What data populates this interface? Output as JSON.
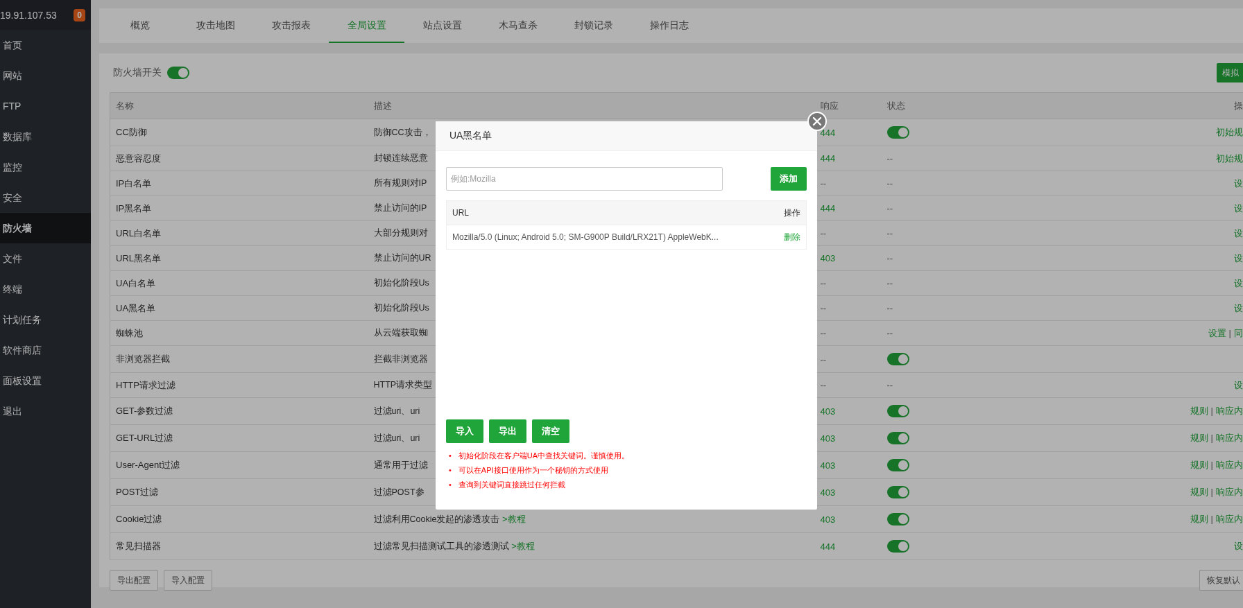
{
  "sidebar": {
    "host": "19.91.107.53",
    "badge": "0",
    "items": [
      {
        "label": "首页",
        "selected": false
      },
      {
        "label": "网站",
        "selected": false
      },
      {
        "label": "FTP",
        "selected": false
      },
      {
        "label": "数据库",
        "selected": false
      },
      {
        "label": "监控",
        "selected": false
      },
      {
        "label": "安全",
        "selected": false
      },
      {
        "label": "防火墙",
        "selected": true
      },
      {
        "label": "文件",
        "selected": false
      },
      {
        "label": "终端",
        "selected": false
      },
      {
        "label": "计划任务",
        "selected": false
      },
      {
        "label": "软件商店",
        "selected": false
      },
      {
        "label": "面板设置",
        "selected": false
      },
      {
        "label": "退出",
        "selected": false
      }
    ]
  },
  "tabs": [
    {
      "label": "概览",
      "selected": false
    },
    {
      "label": "攻击地图",
      "selected": false
    },
    {
      "label": "攻击报表",
      "selected": false
    },
    {
      "label": "全局设置",
      "selected": true
    },
    {
      "label": "站点设置",
      "selected": false
    },
    {
      "label": "木马查杀",
      "selected": false
    },
    {
      "label": "封锁记录",
      "selected": false
    },
    {
      "label": "操作日志",
      "selected": false
    }
  ],
  "firewall_switch": {
    "label": "防火墙开关",
    "on": true
  },
  "simulate_button": "模拟",
  "table": {
    "columns": [
      "名称",
      "描述",
      "响应",
      "状态",
      "操"
    ],
    "op_separator": "|",
    "rows": [
      {
        "name": "CC防御",
        "description": "防御CC攻击，",
        "response": {
          "kind": "code",
          "text": "444"
        },
        "status": {
          "kind": "switch",
          "on": true
        },
        "ops": [
          "初始规"
        ]
      },
      {
        "name": "恶意容忍度",
        "description": "封锁连续恶意",
        "response": {
          "kind": "code",
          "text": "444"
        },
        "status": {
          "kind": "text",
          "text": "--"
        },
        "ops": [
          "初始规"
        ]
      },
      {
        "name": "IP白名单",
        "description": "所有规则对IP",
        "response": {
          "kind": "none",
          "text": "--"
        },
        "status": {
          "kind": "text",
          "text": "--"
        },
        "ops": [
          "设"
        ]
      },
      {
        "name": "IP黑名单",
        "description": "禁止访问的IP",
        "response": {
          "kind": "code",
          "text": "444"
        },
        "status": {
          "kind": "text",
          "text": "--"
        },
        "ops": [
          "设"
        ]
      },
      {
        "name": "URL白名单",
        "description": "大部分规则对",
        "response": {
          "kind": "none",
          "text": "--"
        },
        "status": {
          "kind": "text",
          "text": "--"
        },
        "ops": [
          "设"
        ]
      },
      {
        "name": "URL黑名单",
        "description": "禁止访问的UR",
        "response": {
          "kind": "code",
          "text": "403"
        },
        "status": {
          "kind": "text",
          "text": "--"
        },
        "ops": [
          "设"
        ]
      },
      {
        "name": "UA白名单",
        "description": "初始化阶段Us",
        "response": {
          "kind": "none",
          "text": "--"
        },
        "status": {
          "kind": "text",
          "text": "--"
        },
        "ops": [
          "设"
        ]
      },
      {
        "name": "UA黑名单",
        "description": "初始化阶段Us",
        "response": {
          "kind": "none",
          "text": "--"
        },
        "status": {
          "kind": "text",
          "text": "--"
        },
        "ops": [
          "设"
        ]
      },
      {
        "name": "蜘蛛池",
        "description": "从云端获取蜘",
        "response": {
          "kind": "none",
          "text": "--"
        },
        "status": {
          "kind": "text",
          "text": "--"
        },
        "ops": [
          "设置",
          "同"
        ]
      },
      {
        "name": "非浏览器拦截",
        "description": "拦截非浏览器",
        "response": {
          "kind": "none",
          "text": "--"
        },
        "status": {
          "kind": "switch",
          "on": true
        },
        "ops": []
      },
      {
        "name": "HTTP请求过滤",
        "description": "HTTP请求类型",
        "response": {
          "kind": "none",
          "text": "--"
        },
        "status": {
          "kind": "text",
          "text": "--"
        },
        "ops": [
          "设"
        ]
      },
      {
        "name": "GET-参数过滤",
        "description": "过滤uri、uri",
        "response": {
          "kind": "code",
          "text": "403"
        },
        "status": {
          "kind": "switch",
          "on": true
        },
        "ops": [
          "规则",
          "响应内"
        ]
      },
      {
        "name": "GET-URL过滤",
        "description": "过滤uri、uri",
        "response": {
          "kind": "code",
          "text": "403"
        },
        "status": {
          "kind": "switch",
          "on": true
        },
        "ops": [
          "规则",
          "响应内"
        ]
      },
      {
        "name": "User-Agent过滤",
        "description": "通常用于过滤",
        "response": {
          "kind": "code",
          "text": "403"
        },
        "status": {
          "kind": "switch",
          "on": true
        },
        "ops": [
          "规则",
          "响应内"
        ]
      },
      {
        "name": "POST过滤",
        "description": "过滤POST参",
        "response": {
          "kind": "code",
          "text": "403"
        },
        "status": {
          "kind": "switch",
          "on": true
        },
        "ops": [
          "规则",
          "响应内"
        ]
      },
      {
        "name": "Cookie过滤",
        "description": "过滤利用Cookie发起的渗透攻击",
        "link": ">教程",
        "response": {
          "kind": "code",
          "text": "403"
        },
        "status": {
          "kind": "switch",
          "on": true
        },
        "ops": [
          "规则",
          "响应内"
        ]
      },
      {
        "name": "常见扫描器",
        "description": "过滤常见扫描测试工具的渗透测试",
        "link": ">教程",
        "response": {
          "kind": "code",
          "text": "444"
        },
        "status": {
          "kind": "switch",
          "on": true
        },
        "ops": [
          "设"
        ]
      }
    ]
  },
  "footer_buttons": [
    "导出配置",
    "导入配置"
  ],
  "restore_button": "恢复默认",
  "modal": {
    "title": "UA黑名单",
    "input": {
      "placeholder": "例如:Mozilla"
    },
    "add_button": "添加",
    "columns": [
      "URL",
      "操作"
    ],
    "rows": [
      {
        "ua": "Mozilla/5.0 (Linux; Android 5.0; SM-G900P Build/LRX21T) AppleWebK...",
        "action": "删除"
      }
    ],
    "buttons": [
      "导入",
      "导出",
      "清空"
    ],
    "bullet": "•",
    "notes": [
      "初始化阶段在客户端UA中查找关键词。谨慎使用。",
      "可以在API接口使用作为一个秘钥的方式使用",
      "查询到关键词直接跳过任何拦截"
    ]
  }
}
